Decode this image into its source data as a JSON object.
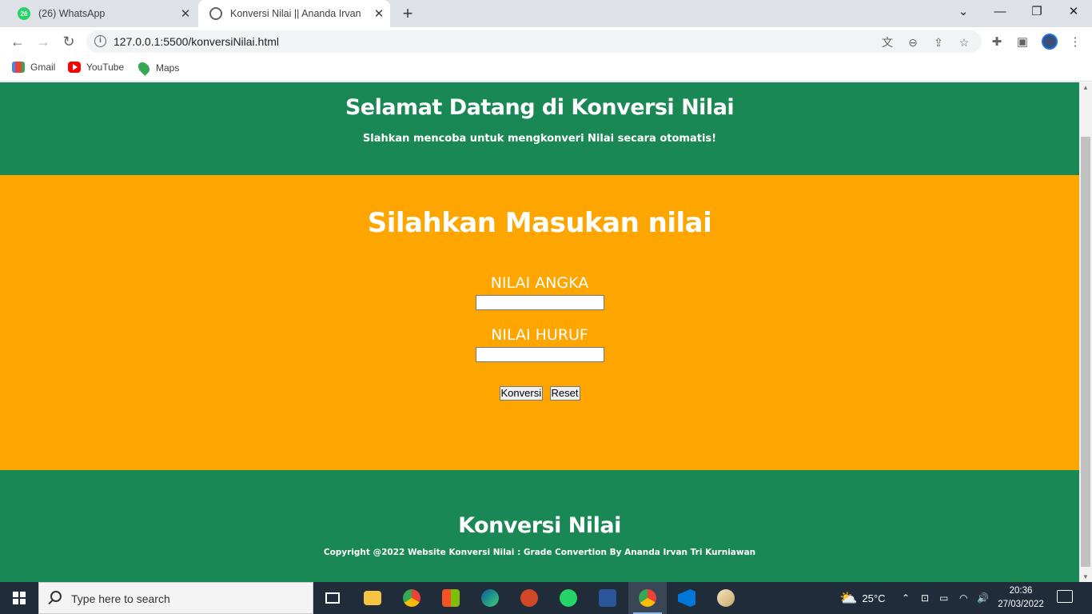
{
  "browser": {
    "tabs": [
      {
        "label": "(26) WhatsApp",
        "badge": "26",
        "active": false
      },
      {
        "label": "Konversi Nilai || Ananda Irvan",
        "active": true
      }
    ],
    "address": "127.0.0.1:5500/konversiNilai.html",
    "bookmarks": [
      {
        "label": "Gmail",
        "icon": "gmail-icon"
      },
      {
        "label": "YouTube",
        "icon": "youtube-icon"
      },
      {
        "label": "Maps",
        "icon": "maps-icon"
      }
    ]
  },
  "page": {
    "header": {
      "title": "Selamat Datang di Konversi Nilai",
      "subtitle": "Slahkan mencoba untuk mengkonveri Nilai secara otomatis!"
    },
    "form": {
      "heading": "Silahkan Masukan nilai",
      "angka_label": "NILAI ANGKA",
      "angka_value": "",
      "huruf_label": "NILAI HURUF",
      "huruf_value": "",
      "convert_button": "Konversi",
      "reset_button": "Reset"
    },
    "footer": {
      "title": "Konversi Nilai",
      "copyright": "Copyright @2022 Website Konversi Nilai : Grade Convertion By Ananda Irvan Tri Kurniawan"
    }
  },
  "taskbar": {
    "search_placeholder": "Type here to search",
    "weather": "25°C",
    "time": "20:36",
    "date": "27/03/2022"
  },
  "colors": {
    "header_green": "#1a8855",
    "body_orange": "#ffa500"
  }
}
